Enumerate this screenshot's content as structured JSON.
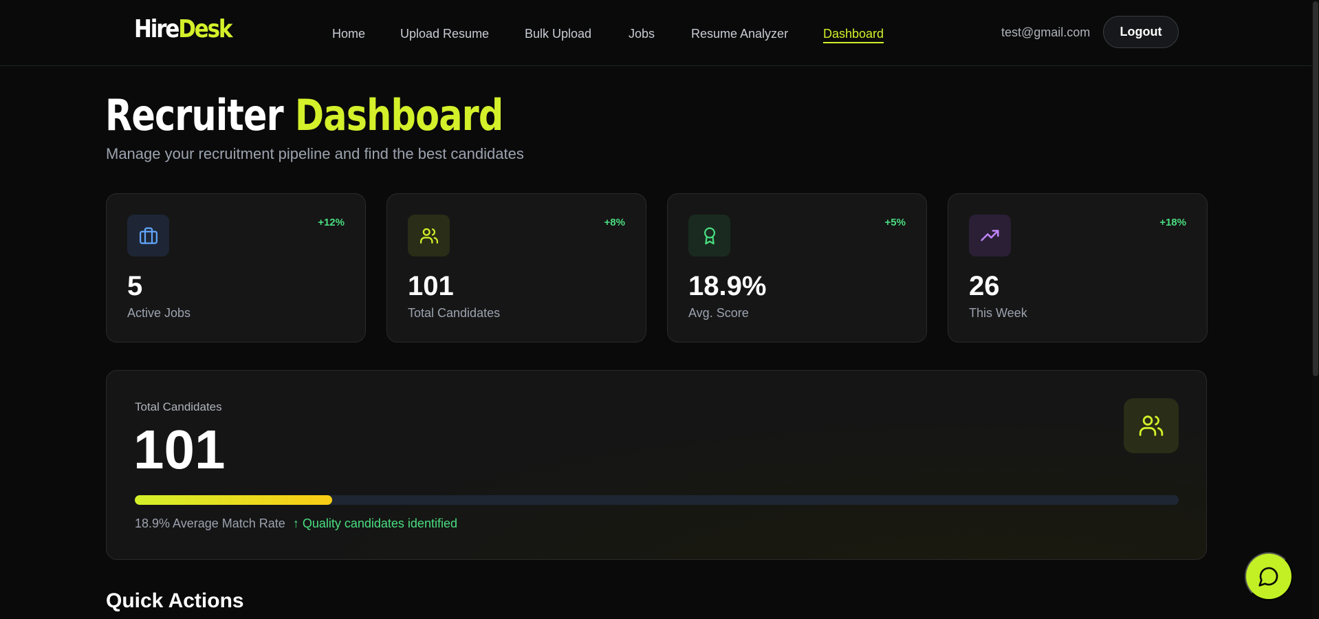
{
  "app": {
    "logo_part1": "Hire",
    "logo_part2": "Desk"
  },
  "nav": {
    "items": [
      {
        "label": "Home"
      },
      {
        "label": "Upload Resume"
      },
      {
        "label": "Bulk Upload"
      },
      {
        "label": "Jobs"
      },
      {
        "label": "Resume Analyzer"
      },
      {
        "label": "Dashboard",
        "active": true
      }
    ],
    "user_email": "test@gmail.com",
    "logout_label": "Logout"
  },
  "header": {
    "title_part1": "Recruiter",
    "title_part2": "Dashboard",
    "subtitle": "Manage your recruitment pipeline and find the best candidates"
  },
  "stats": [
    {
      "value": "5",
      "label": "Active Jobs",
      "change": "+12%",
      "icon": "briefcase-icon",
      "color": "#60a5fa"
    },
    {
      "value": "101",
      "label": "Total Candidates",
      "change": "+8%",
      "icon": "users-icon",
      "color": "#d4f02a"
    },
    {
      "value": "18.9%",
      "label": "Avg. Score",
      "change": "+5%",
      "icon": "award-icon",
      "color": "#4ade80"
    },
    {
      "value": "26",
      "label": "This Week",
      "change": "+18%",
      "icon": "trending-up-icon",
      "color": "#c084fc"
    }
  ],
  "summary": {
    "label": "Total Candidates",
    "value": "101",
    "icon": "users-icon",
    "match_rate_percent": 18.9,
    "match_text": "18.9% Average Match Rate",
    "quality_text": "↑ Quality candidates identified"
  },
  "quick_actions": {
    "title": "Quick Actions"
  },
  "chat": {
    "icon": "chat-bubble-icon"
  },
  "colors": {
    "accent": "#d4f02a",
    "positive": "#4ade80",
    "background": "#0a0a0a"
  }
}
